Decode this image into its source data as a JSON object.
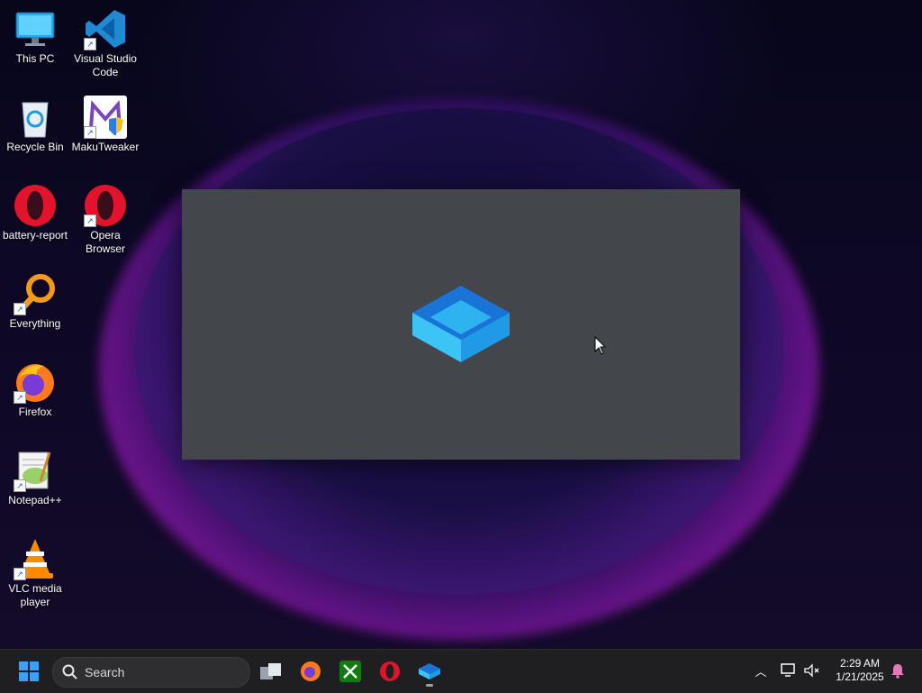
{
  "desktop": {
    "icons": [
      {
        "label": "This PC"
      },
      {
        "label": "Visual Studio Code"
      },
      {
        "label": "Recycle Bin"
      },
      {
        "label": "MakuTweaker"
      },
      {
        "label": "battery-report"
      },
      {
        "label": "Opera Browser"
      },
      {
        "label": "Everything"
      },
      {
        "label": "Firefox"
      },
      {
        "label": "Notepad++"
      },
      {
        "label": "VLC media player"
      }
    ]
  },
  "taskbar": {
    "search_placeholder": "Search",
    "pinned": [
      "start-icon",
      "search",
      "task-view-icon",
      "firefox-icon",
      "xbox-icon",
      "opera-icon",
      "sandbox-icon"
    ],
    "clock_time": "2:29 AM",
    "clock_date": "1/21/2025"
  },
  "colors": {
    "splash_bg": "#43464a",
    "taskbar_bg": "#1f1f22",
    "accent_blue": "#1e90ff"
  }
}
